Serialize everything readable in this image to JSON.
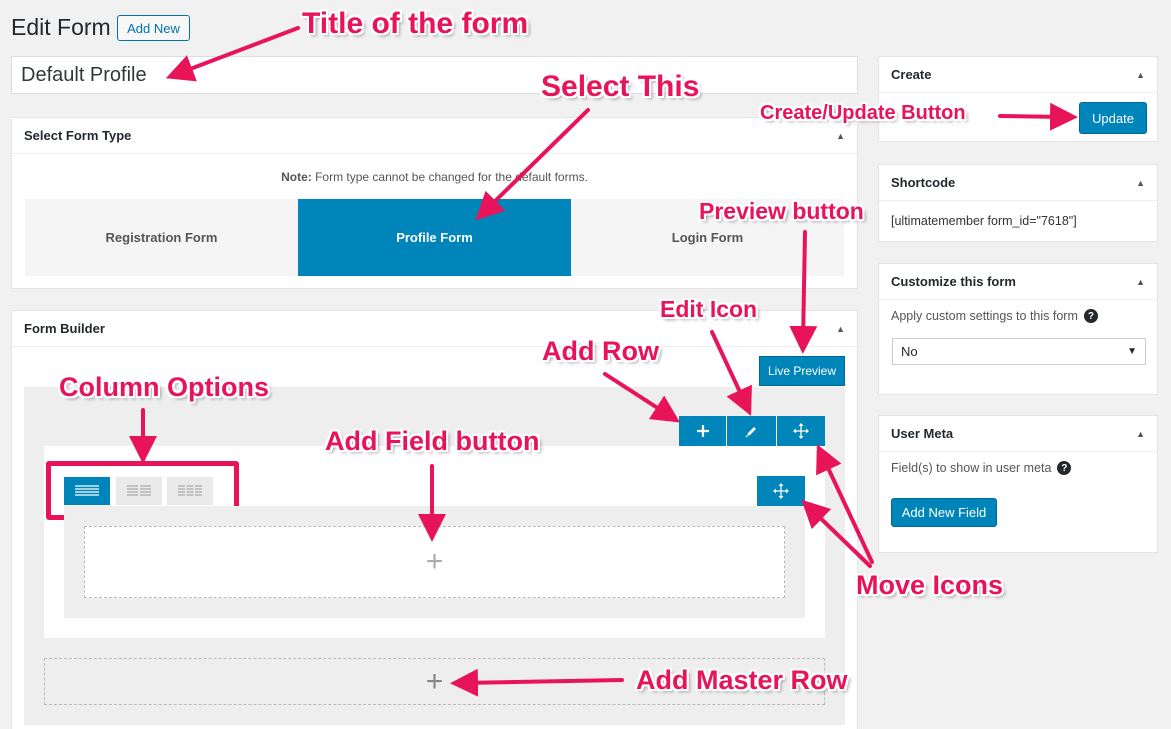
{
  "header": {
    "title": "Edit Form",
    "add_new": "Add New"
  },
  "form_title": {
    "value": "Default Profile"
  },
  "form_type": {
    "heading": "Select Form Type",
    "note_label": "Note:",
    "note_text": " Form type cannot be changed for the default forms.",
    "options": [
      "Registration Form",
      "Profile Form",
      "Login Form"
    ],
    "selected": "Profile Form"
  },
  "builder": {
    "heading": "Form Builder",
    "live_preview": "Live Preview",
    "add_symbol": "+"
  },
  "sidebar": {
    "create": {
      "heading": "Create",
      "update": "Update"
    },
    "shortcode": {
      "heading": "Shortcode",
      "value": "[ultimatemember form_id=\"7618\"]"
    },
    "customize": {
      "heading": "Customize this form",
      "label": "Apply custom settings to this form",
      "selected": "No"
    },
    "user_meta": {
      "heading": "User Meta",
      "label": "Field(s) to show in user meta",
      "add_field": "Add New Field"
    }
  },
  "annotations": {
    "title": "Title of the form",
    "select_this": "Select This",
    "create_update": "Create/Update Button",
    "preview": "Preview button",
    "edit_icon": "Edit Icon",
    "add_row": "Add Row",
    "column_options": "Column Options",
    "add_field": "Add Field button",
    "move_icons": "Move Icons",
    "add_master_row": "Add Master Row"
  },
  "colors": {
    "accent": "#0085ba",
    "annotation": "#e8145a",
    "highlight_box": "#e8145a"
  }
}
